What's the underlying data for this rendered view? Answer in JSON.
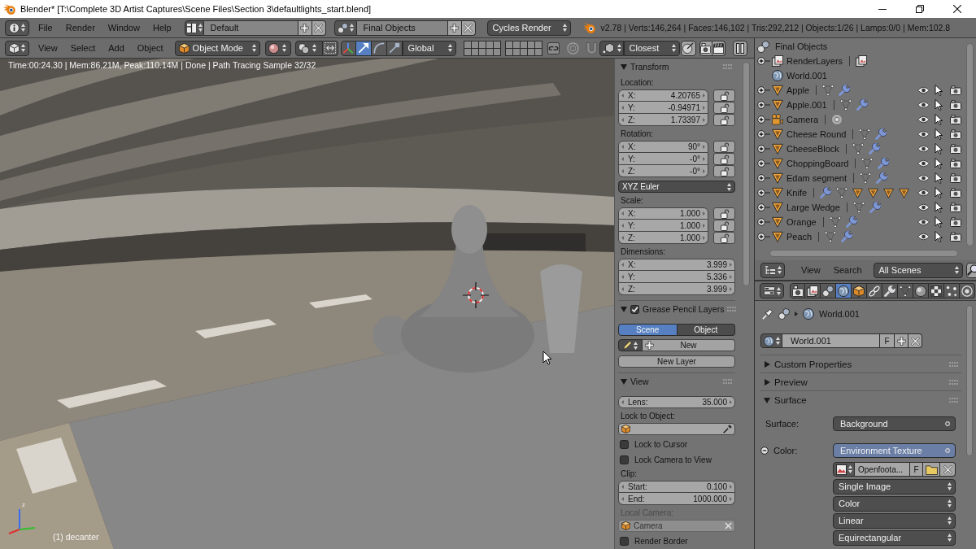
{
  "window": {
    "title": "Blender* [T:\\Complete 3D Artist Captures\\Scene Files\\Section 3\\defaultlights_start.blend]"
  },
  "info_header": {
    "menus": [
      "File",
      "Render",
      "Window",
      "Help"
    ],
    "layout": "Default",
    "scene": "Final Objects",
    "render_engine": "Cycles Render",
    "stats": "v2.78 | Verts:146,264 | Faces:146,102 | Tris:292,212 | Objects:1/26 | Lamps:0/0 | Mem:102.8"
  },
  "viewport_header": {
    "menus": [
      "View",
      "Select",
      "Add",
      "Object"
    ],
    "mode": "Object Mode",
    "manipulators": [
      {
        "kind": "toggle",
        "selected": false
      },
      {
        "kind": "translate",
        "selected": true
      },
      {
        "kind": "rotate",
        "selected": false
      },
      {
        "kind": "scale",
        "selected": false
      }
    ],
    "orientation": "Global",
    "snap_target": "Closest"
  },
  "viewport": {
    "render_info": "Time:00:24.30 | Mem:86.21M, Peak:110.14M | Done | Path Tracing Sample 32/32",
    "gizmo_label": "z",
    "object_info": "(1) decanter"
  },
  "n_panel": {
    "panels": [
      {
        "title": "Transform",
        "expanded": true,
        "rows": [
          {
            "kind": "label",
            "text": "Location:"
          },
          {
            "kind": "vector",
            "fields": [
              {
                "label": "X:",
                "value": "4.20765",
                "locked": false
              },
              {
                "label": "Y:",
                "value": "-0.94971",
                "locked": false
              },
              {
                "label": "Z:",
                "value": "1.73397",
                "locked": false
              }
            ]
          },
          {
            "kind": "label",
            "text": "Rotation:"
          },
          {
            "kind": "vector",
            "fields": [
              {
                "label": "X:",
                "value": "90°",
                "locked": false
              },
              {
                "label": "Y:",
                "value": "-0°",
                "locked": false
              },
              {
                "label": "Z:",
                "value": "-0°",
                "locked": false
              }
            ]
          },
          {
            "kind": "dropdown",
            "text": "XYZ Euler"
          },
          {
            "kind": "label",
            "text": "Scale:"
          },
          {
            "kind": "vector",
            "fields": [
              {
                "label": "X:",
                "value": "1.000",
                "locked": false
              },
              {
                "label": "Y:",
                "value": "1.000",
                "locked": false
              },
              {
                "label": "Z:",
                "value": "1.000",
                "locked": false
              }
            ]
          },
          {
            "kind": "label",
            "text": "Dimensions:"
          },
          {
            "kind": "vector",
            "fields": [
              {
                "label": "X:",
                "value": "3.999"
              },
              {
                "label": "Y:",
                "value": "5.336"
              },
              {
                "label": "Z:",
                "value": "3.999"
              }
            ]
          }
        ]
      },
      {
        "title": "Grease Pencil Layers",
        "expanded": true,
        "checked": true,
        "rows": [
          {
            "kind": "toggle_group",
            "options": [
              {
                "label": "Scene",
                "selected": true
              },
              {
                "label": "Object",
                "selected": false
              }
            ]
          },
          {
            "kind": "new_button",
            "text": "New"
          },
          {
            "kind": "button",
            "text": "New Layer"
          }
        ]
      },
      {
        "title": "View",
        "expanded": true,
        "rows": [
          {
            "kind": "number",
            "label": "Lens:",
            "value": "35.000"
          },
          {
            "kind": "object_field",
            "label": "Lock to Object:",
            "disabled": false
          },
          {
            "kind": "checkbox",
            "label": "Lock to Cursor",
            "checked": false
          },
          {
            "kind": "checkbox",
            "label": "Lock Camera to View",
            "checked": false
          },
          {
            "kind": "label",
            "text": "Clip:"
          },
          {
            "kind": "vector",
            "fields": [
              {
                "label": "Start:",
                "value": "0.100"
              },
              {
                "label": "End:",
                "value": "1000.000"
              }
            ]
          },
          {
            "kind": "object_field",
            "label": "Local Camera:",
            "value": "Camera",
            "disabled": true
          },
          {
            "kind": "checkbox",
            "label": "Render Border",
            "checked": false
          }
        ]
      }
    ]
  },
  "outliner": {
    "root": {
      "kind": "scene",
      "name": "Final Objects",
      "children": [
        {
          "kind": "render_layers",
          "name": "RenderLayers",
          "expanded": false,
          "data": [
            {
              "kind": "render_layers"
            }
          ]
        },
        {
          "kind": "world",
          "name": "World.001"
        },
        {
          "kind": "mesh",
          "name": "Apple",
          "expanded": false,
          "data": [
            {
              "kind": "mesh_data"
            },
            {
              "kind": "modifier"
            }
          ],
          "visible": true,
          "selectable": true,
          "renderable": true
        },
        {
          "kind": "mesh",
          "name": "Apple.001",
          "expanded": false,
          "data": [
            {
              "kind": "mesh_data"
            },
            {
              "kind": "modifier"
            }
          ],
          "visible": true,
          "selectable": true,
          "renderable": true
        },
        {
          "kind": "camera",
          "name": "Camera",
          "expanded": false,
          "data": [
            {
              "kind": "camera_data"
            }
          ],
          "visible": true,
          "selectable": true,
          "renderable": true
        },
        {
          "kind": "mesh",
          "name": "Cheese Round",
          "expanded": false,
          "data": [
            {
              "kind": "mesh_data"
            },
            {
              "kind": "modifier"
            }
          ],
          "visible": true,
          "selectable": true,
          "renderable": true
        },
        {
          "kind": "mesh",
          "name": "CheeseBlock",
          "expanded": false,
          "data": [
            {
              "kind": "mesh_data"
            },
            {
              "kind": "modifier"
            }
          ],
          "visible": true,
          "selectable": true,
          "renderable": true
        },
        {
          "kind": "mesh",
          "name": "ChoppingBoard",
          "expanded": false,
          "data": [
            {
              "kind": "mesh_data"
            },
            {
              "kind": "modifier"
            }
          ],
          "visible": true,
          "selectable": true,
          "renderable": true
        },
        {
          "kind": "mesh",
          "name": "Edam segment",
          "expanded": false,
          "data": [
            {
              "kind": "mesh_data"
            },
            {
              "kind": "modifier"
            }
          ],
          "visible": true,
          "selectable": true,
          "renderable": true
        },
        {
          "kind": "mesh",
          "name": "Knife",
          "expanded": false,
          "data": [
            {
              "kind": "modifier"
            },
            {
              "kind": "mesh_data"
            },
            {
              "kind": "mesh"
            },
            {
              "kind": "mesh"
            },
            {
              "kind": "mesh"
            },
            {
              "kind": "mesh"
            }
          ],
          "visible": true,
          "selectable": true,
          "renderable": true
        },
        {
          "kind": "mesh",
          "name": "Large Wedge",
          "expanded": false,
          "data": [
            {
              "kind": "mesh_data"
            },
            {
              "kind": "modifier"
            }
          ],
          "visible": true,
          "selectable": true,
          "renderable": true
        },
        {
          "kind": "mesh",
          "name": "Orange",
          "expanded": false,
          "data": [
            {
              "kind": "mesh_data"
            },
            {
              "kind": "modifier"
            }
          ],
          "visible": true,
          "selectable": true,
          "renderable": true
        },
        {
          "kind": "mesh",
          "name": "Peach",
          "expanded": false,
          "data": [
            {
              "kind": "mesh_data"
            },
            {
              "kind": "modifier"
            }
          ],
          "visible": true,
          "selectable": true,
          "renderable": true
        }
      ]
    },
    "footer": {
      "menus": [
        "View",
        "Search"
      ],
      "filter": "All Scenes"
    }
  },
  "properties": {
    "tabs": [
      {
        "kind": "render",
        "selected": false
      },
      {
        "kind": "render_layers",
        "selected": false
      },
      {
        "kind": "scene",
        "selected": false
      },
      {
        "kind": "world",
        "selected": true
      },
      {
        "kind": "object",
        "selected": false
      },
      {
        "kind": "constraints",
        "selected": false
      },
      {
        "kind": "modifiers",
        "selected": false
      },
      {
        "kind": "data",
        "selected": false
      },
      {
        "kind": "material",
        "selected": false
      },
      {
        "kind": "texture",
        "selected": false
      },
      {
        "kind": "particles",
        "selected": false
      },
      {
        "kind": "physics",
        "selected": false
      }
    ],
    "breadcrumb": "World.001",
    "world": {
      "name": "World.001",
      "fake_user": "F"
    },
    "panels": [
      {
        "title": "Custom Properties",
        "expanded": false
      },
      {
        "title": "Preview",
        "expanded": false
      },
      {
        "title": "Surface",
        "expanded": true,
        "rows": [
          {
            "kind": "node",
            "label": "Surface:",
            "value": "Background",
            "highlighted": false
          },
          {
            "kind": "node_input",
            "label": "Color:",
            "value": "Environment Texture",
            "highlighted": true,
            "expanded": true
          },
          {
            "kind": "image",
            "value": "Openfoota...",
            "fake_user": "F"
          },
          {
            "kind": "dropdown",
            "text": "Single Image"
          },
          {
            "kind": "dropdown",
            "text": "Color"
          },
          {
            "kind": "dropdown",
            "text": "Linear"
          },
          {
            "kind": "dropdown",
            "text": "Equirectangular"
          }
        ]
      }
    ]
  }
}
